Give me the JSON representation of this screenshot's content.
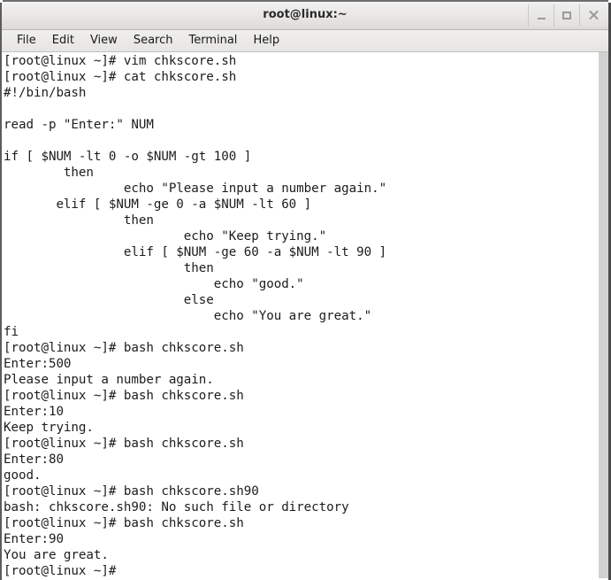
{
  "window": {
    "title": "root@linux:~",
    "buttons": {
      "minimize": "minimize",
      "maximize": "maximize",
      "close": "close"
    }
  },
  "menubar": {
    "items": [
      {
        "label": "File"
      },
      {
        "label": "Edit"
      },
      {
        "label": "View"
      },
      {
        "label": "Search"
      },
      {
        "label": "Terminal"
      },
      {
        "label": "Help"
      }
    ]
  },
  "terminal": {
    "lines": [
      "[root@linux ~]# vim chkscore.sh",
      "[root@linux ~]# cat chkscore.sh",
      "#!/bin/bash",
      "",
      "read -p \"Enter:\" NUM",
      "",
      "if [ $NUM -lt 0 -o $NUM -gt 100 ]",
      "        then",
      "                echo \"Please input a number again.\"",
      "       elif [ $NUM -ge 0 -a $NUM -lt 60 ]",
      "                then",
      "                        echo \"Keep trying.\"",
      "                elif [ $NUM -ge 60 -a $NUM -lt 90 ]",
      "                        then",
      "                            echo \"good.\"",
      "                        else",
      "                            echo \"You are great.\"",
      "fi",
      "[root@linux ~]# bash chkscore.sh",
      "Enter:500",
      "Please input a number again.",
      "[root@linux ~]# bash chkscore.sh",
      "Enter:10",
      "Keep trying.",
      "[root@linux ~]# bash chkscore.sh",
      "Enter:80",
      "good.",
      "[root@linux ~]# bash chkscore.sh90",
      "bash: chkscore.sh90: No such file or directory",
      "[root@linux ~]# bash chkscore.sh",
      "Enter:90",
      "You are great.",
      "[root@linux ~]#"
    ]
  },
  "scrollbar": {
    "name": "vertical-scrollbar"
  },
  "colors": {
    "titlebar": "#e8e7e5",
    "menubar": "#e6e5e3",
    "terminal_bg": "#ffffff",
    "terminal_fg": "#1c1c1c",
    "scrollbar": "#d2d1cf",
    "frame": "#5c5c5c"
  }
}
